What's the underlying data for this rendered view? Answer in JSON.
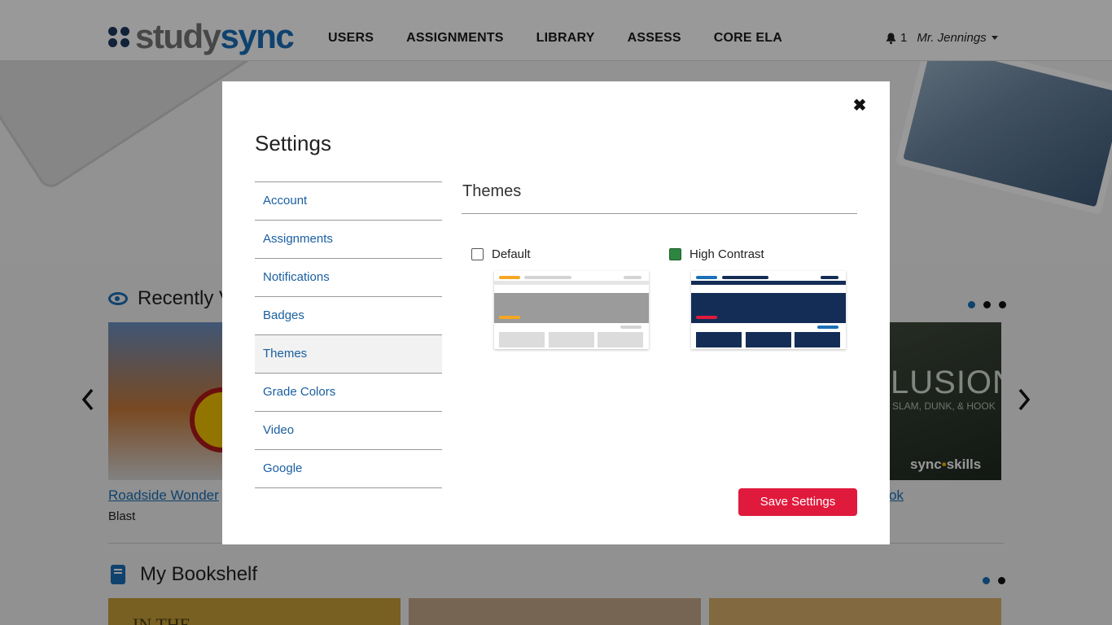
{
  "header": {
    "logo_study": "study",
    "logo_sync": "sync",
    "nav": [
      "USERS",
      "ASSIGNMENTS",
      "LIBRARY",
      "ASSESS",
      "CORE ELA"
    ],
    "notification_count": "1",
    "user_name": "Mr. Jennings"
  },
  "recently": {
    "title": "Recently V",
    "card1_link": "Roadside Wonder",
    "card1_type": "Blast",
    "card2_big": "LUSION",
    "card2_small": "SLAM, DUNK, & HOOK",
    "card2_brand_a": "sync",
    "card2_brand_dot": "•",
    "card2_brand_b": "skills",
    "card2_link": "ok"
  },
  "bookshelf": {
    "title": "My Bookshelf",
    "card1_text": "IN THE"
  },
  "modal": {
    "title": "Settings",
    "close_icon": "✖",
    "nav": [
      "Account",
      "Assignments",
      "Notifications",
      "Badges",
      "Themes",
      "Grade Colors",
      "Video",
      "Google"
    ],
    "active_nav": "Themes",
    "panel_title": "Themes",
    "themes": [
      {
        "label": "Default",
        "checked": false
      },
      {
        "label": "High Contrast",
        "checked": true
      }
    ],
    "save_label": "Save Settings"
  },
  "colors": {
    "brand_blue": "#1a6fb7",
    "save_red": "#e01a3c",
    "check_green": "#2e8540",
    "contrast_navy": "#142d56",
    "default_orange": "#f5a623"
  }
}
